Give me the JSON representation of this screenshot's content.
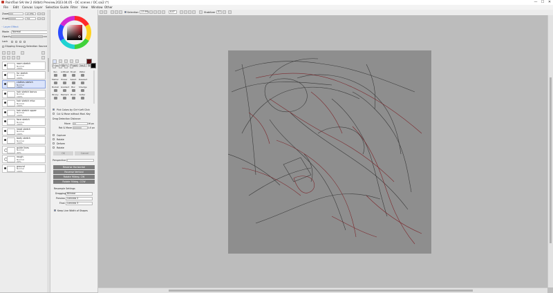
{
  "window": {
    "title": "PaintTool SAI Ver.2 (64bit) Preview.2023.04.05 - OC scenes / OC.sai2 (*)",
    "minimize": "—",
    "maximize": "☐",
    "close": "✕"
  },
  "menu": [
    "File",
    "Edit",
    "Canvas",
    "Layer",
    "Selection",
    "Guide",
    "Filter",
    "View",
    "Window",
    "Other"
  ],
  "toolbar": {
    "selection_label": "Selection",
    "zoom": "17.9%",
    "angle": "0.0°",
    "stabilizer_label": "Stabilizer",
    "stabilizer_value": "S1"
  },
  "nav": {
    "zoom_label": "Zoom",
    "zoom_value": "17.9%",
    "angle_label": "Angle",
    "angle_value": "+0"
  },
  "layer_props": {
    "effect_header": "◦ Layer Effect",
    "mode_label": "Mode",
    "mode_value": "Normal",
    "opacity_label": "Opacity",
    "opacity_value": "100%",
    "lock_label": "Lock",
    "clipping_label": "Clipping Group",
    "selection_source_label": "Selection Source"
  },
  "layers": [
    {
      "name": "room sketch",
      "mode": "Normal",
      "opacity": "100%"
    },
    {
      "name": "fur sketch",
      "mode": "Normal",
      "opacity": "100%"
    },
    {
      "name": "clothes sketch",
      "mode": "Normal",
      "opacity": "100%"
    },
    {
      "name": "hair sketch bonus",
      "mode": "Normal",
      "opacity": "100%"
    },
    {
      "name": "hair sketch misc",
      "mode": "Normal",
      "opacity": "100%"
    },
    {
      "name": "hair sketch upper",
      "mode": "Normal",
      "opacity": "100%"
    },
    {
      "name": "face sketch",
      "mode": "Normal",
      "opacity": "100%"
    },
    {
      "name": "head sketch",
      "mode": "Normal",
      "opacity": "100%"
    },
    {
      "name": "body sketch",
      "mode": "Normal",
      "opacity": "100%"
    },
    {
      "name": "guide lines",
      "mode": "Normal",
      "opacity": "40%"
    },
    {
      "name": "rough",
      "mode": "Normal",
      "opacity": "20%"
    },
    {
      "name": "ground",
      "mode": "Normal",
      "opacity": "100%"
    }
  ],
  "colors": {
    "primary": "#5a0d10",
    "secondary": "#000000",
    "accent": "#4a7bd8",
    "paper": "#8e8e8e",
    "sketch_red": "#7a1d22",
    "sketch_dark": "#2b2b2b"
  },
  "tool_tabs": [
    "Select",
    "Stab.",
    "Brush",
    "Ins.1",
    "Modes"
  ],
  "tools": [
    "Pen",
    "AirBrush",
    "Brush",
    "Water",
    "Marker",
    "Eraser",
    "Select",
    "Deselect",
    "Bucket",
    "Gradient",
    "Blur",
    "Smudge",
    "Binary",
    "Marker2",
    "Blur2",
    "Cutter"
  ],
  "tool_options": {
    "pick_colors": "Pick Colors by Ctrl+Left Click",
    "cut_move": "Cut & Move without Mod. Key",
    "drag_header": "Drag Detection Distance",
    "move_label": "Move",
    "move_value": "16 px",
    "rot_label": "Rot & Move",
    "rot_value": "1.0 px",
    "opt1": "Capture",
    "opt2": "Rotate",
    "opt3": "Deform",
    "opt4": "Rotate",
    "ok": "OK",
    "cancel": "Cancel",
    "perspective_label": "Perspective",
    "reverse_h": "Reverse Horizontal",
    "reverse_v": "Reverse Vertical",
    "rotate_cw": "Rotate 90deg. CW",
    "rotate_ccw": "Rotate 90deg. CCW",
    "resample_header": "Resample Settings",
    "dragging_label": "Dragging",
    "dragging_value": "Bilinear",
    "preview_label": "Preview",
    "preview_value": "Lanczos 2",
    "final_label": "Final",
    "final_value": "Lanczos 3",
    "keep_width": "Keep Line Width of Shapes"
  }
}
